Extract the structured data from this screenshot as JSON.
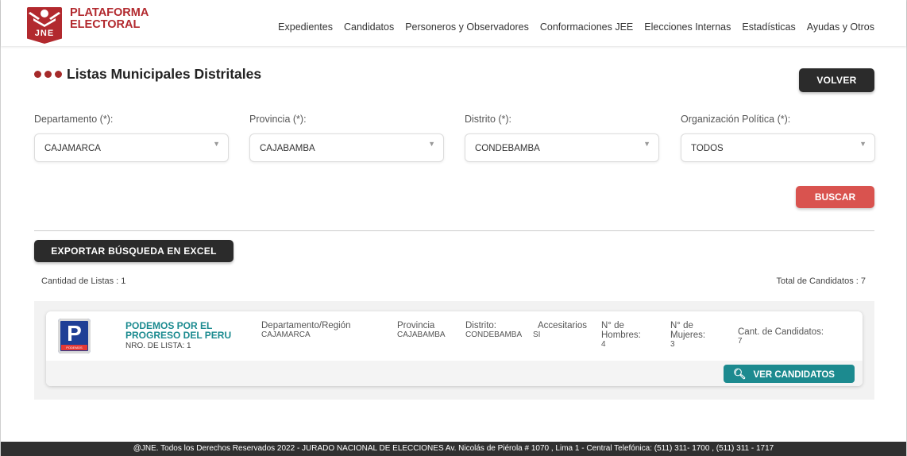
{
  "header": {
    "brand_line1": "PLATAFORMA",
    "brand_line2": "ELECTORAL",
    "logo_text": "JNE",
    "nav": [
      "Expedientes",
      "Candidatos",
      "Personeros y Observadores",
      "Conformaciones JEE",
      "Elecciones Internas",
      "Estadísticas",
      "Ayudas y Otros"
    ]
  },
  "page": {
    "title": "Listas Municipales Distritales",
    "back_label": "VOLVER"
  },
  "filters": {
    "departamento": {
      "label": "Departamento (*):",
      "value": "CAJAMARCA"
    },
    "provincia": {
      "label": "Provincia (*):",
      "value": "CAJABAMBA"
    },
    "distrito": {
      "label": "Distrito (*):",
      "value": "CONDEBAMBA"
    },
    "organizacion": {
      "label": "Organización Política (*):",
      "value": "TODOS"
    },
    "search_label": "BUSCAR"
  },
  "results": {
    "export_label": "EXPORTAR BÚSQUEDA EN EXCEL",
    "count_lists": "Cantidad de Listas : 1",
    "total_candidates": "Total de Candidatos : 7",
    "card": {
      "party_logo_letter": "P",
      "party_logo_sub": "PODEMOS",
      "party_name_1": "PODEMOS POR EL",
      "party_name_2": "PROGRESO DEL PERU",
      "nro_lista": "NRO. DE LISTA: 1",
      "departamento_label": "Departamento/Región",
      "departamento_value": "CAJAMARCA",
      "provincia_label": "Provincia",
      "provincia_value": "CAJABAMBA",
      "distrito_label": "Distrito:",
      "distrito_value": "CONDEBAMBA",
      "accesitarios_label": "Accesitarios",
      "accesitarios_value": "SI",
      "hombres_label_1": "N° de",
      "hombres_label_2": "Hombres:",
      "hombres_value": "4",
      "mujeres_label_1": "N° de",
      "mujeres_label_2": "Mujeres:",
      "mujeres_value": "3",
      "cant_label": "Cant. de Candidatos:",
      "cant_value": "7",
      "ver_label": "VER CANDIDATOS"
    }
  },
  "footer": {
    "text": "@JNE. Todos los Derechos Reservados 2022  -  JURADO NACIONAL DE ELECCIONES Av. Nicolás de Piérola # 1070 , Lima 1 - Central Telefónica: (511) 311- 1700 , (511) 311 - 1717"
  },
  "colors": {
    "brand_red": "#b2292e",
    "teal": "#1c8a8f",
    "dark_button": "#2b2b2b",
    "search_button": "#d9534f"
  }
}
